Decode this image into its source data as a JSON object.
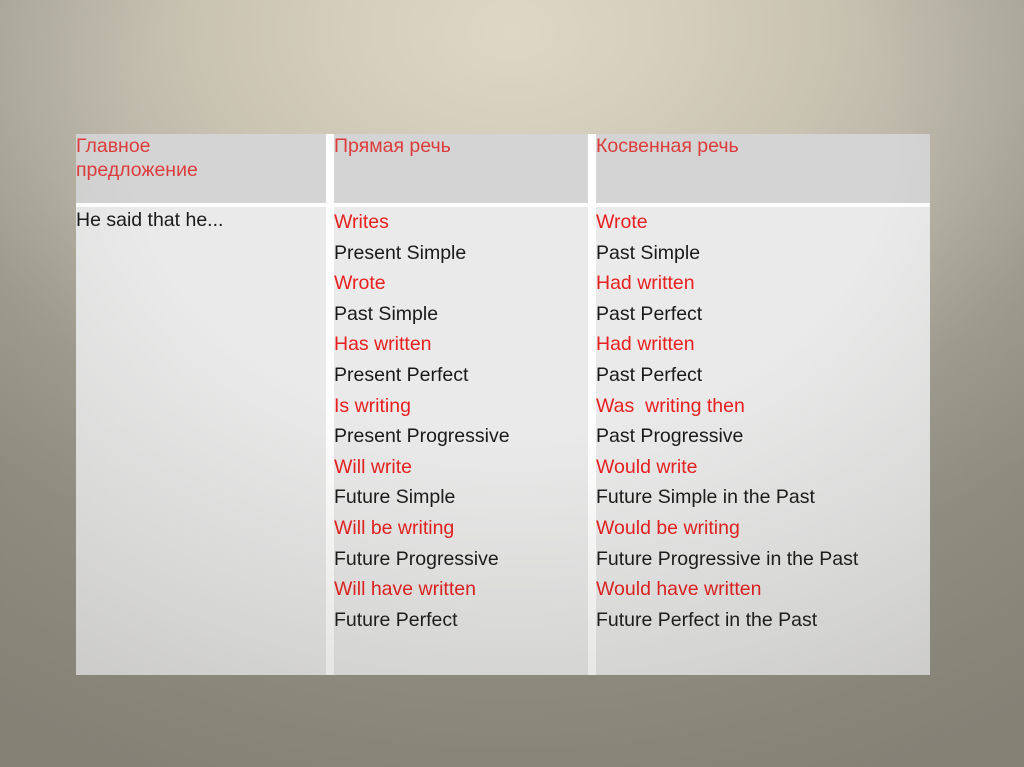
{
  "slide": {
    "background_top_color": "#ded7c6",
    "background_edge_color": "#989688",
    "header_bg_color": "#d4d4d4",
    "body_bg_color": "#eaeaea",
    "accent_red": "#e8201f",
    "header_red": "#dd3c3c",
    "text_black": "#1a1a1a"
  },
  "table": {
    "headers": [
      "Главное\nпредложение",
      "Прямая речь",
      "Косвенная речь"
    ],
    "subject": "He said that he...",
    "direct_speech": [
      {
        "form": "Writes",
        "tense": "Present Simple"
      },
      {
        "form": "Wrote",
        "tense": "Past Simple"
      },
      {
        "form": "Has written",
        "tense": "Present Perfect"
      },
      {
        "form": "Is writing",
        "tense": "Present Progressive"
      },
      {
        "form": "Will write",
        "tense": "Future Simple"
      },
      {
        "form": "Will be writing",
        "tense": "Future Progressive"
      },
      {
        "form": "Will have written",
        "tense": "Future Perfect"
      }
    ],
    "reported_speech": [
      {
        "form": "Wrote",
        "tense": "Past Simple"
      },
      {
        "form": "Had written",
        "tense": "Past Perfect"
      },
      {
        "form": "Had written",
        "tense": "Past Perfect"
      },
      {
        "form": "Was  writing then",
        "tense": "Past Progressive"
      },
      {
        "form": "Would write",
        "tense": "Future Simple in the Past"
      },
      {
        "form": "Would be writing",
        "tense": "Future Progressive in the Past"
      },
      {
        "form": "Would have written",
        "tense": "Future Perfect in the Past"
      }
    ]
  }
}
